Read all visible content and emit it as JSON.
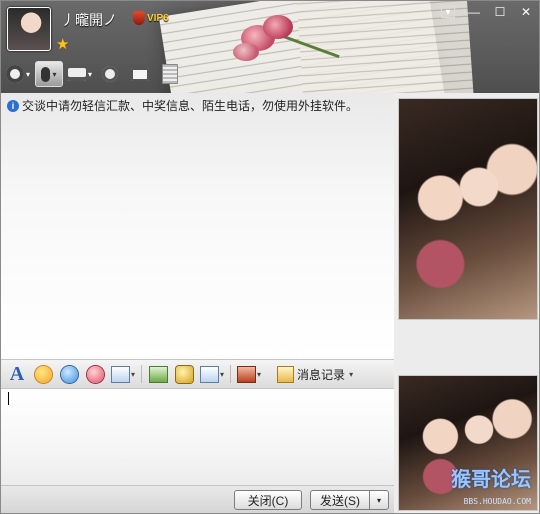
{
  "header": {
    "nickname": "丿曨開ノ",
    "vip_label": "VIP6",
    "star_glyph": "★",
    "window_buttons": [
      "▾",
      "—",
      "☐",
      "✕"
    ]
  },
  "toolbar_top": {
    "items": [
      "video-call-icon",
      "voice-call-icon",
      "send-file-icon",
      "add-member-icon",
      "remote-assist-icon",
      "notes-icon"
    ]
  },
  "message_area": {
    "notice": "交谈中请勿轻信汇款、中奖信息、陌生电话，勿使用外挂软件。",
    "info_glyph": "i"
  },
  "input_toolbar": {
    "history_label": "消息记录",
    "font_glyph": "A",
    "dropdown_glyph": "▾"
  },
  "bottom": {
    "close_label": "关闭(C)",
    "send_label": "发送(S)",
    "send_menu_glyph": "▾"
  },
  "watermark": {
    "main": "猴哥论坛",
    "sub": "BBS.HOUDAO.COM"
  },
  "colors": {
    "accent": "#2b5fb3",
    "header": "#5a5a5a"
  }
}
